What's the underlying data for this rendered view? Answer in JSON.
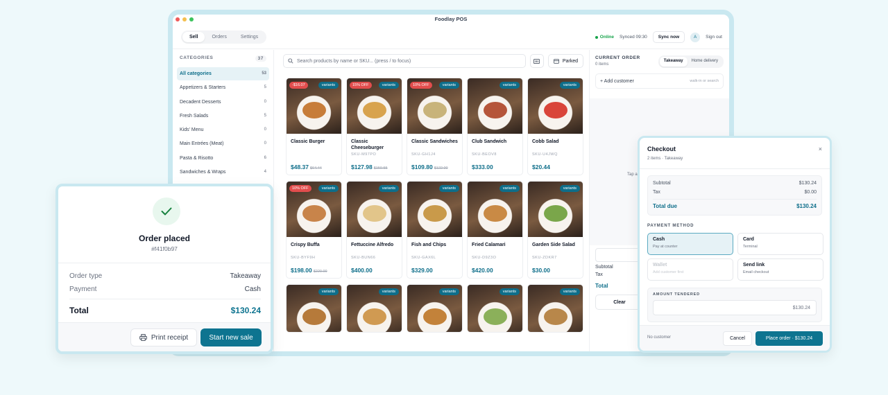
{
  "app": {
    "title": "Foodlay POS",
    "tabs": [
      {
        "label": "Sell",
        "active": true
      },
      {
        "label": "Orders",
        "active": false
      },
      {
        "label": "Settings",
        "active": false
      }
    ],
    "status": "Online",
    "synced": "Synced 09:30",
    "sync_button": "Sync now",
    "avatar": "A",
    "sign_out": "Sign out"
  },
  "sidebar": {
    "heading": "CATEGORIES",
    "count": "37",
    "items": [
      {
        "label": "All categories",
        "count": "53",
        "active": true
      },
      {
        "label": "Appetizers & Starters",
        "count": "5"
      },
      {
        "label": "Decadent Desserts",
        "count": "0"
      },
      {
        "label": "Fresh Salads",
        "count": "5"
      },
      {
        "label": "Kids' Menu",
        "count": "0"
      },
      {
        "label": "Main Entrées (Meat)",
        "count": "0"
      },
      {
        "label": "Pasta & Risotto",
        "count": "6"
      },
      {
        "label": "Sandwiches & Wraps",
        "count": "4"
      }
    ]
  },
  "search": {
    "placeholder": "Search products by name or SKU...  (press / to focus)",
    "parked_label": "Parked"
  },
  "products": [
    {
      "name": "Classic Burger",
      "sku": "",
      "price": "$48.37",
      "old": "$64.44",
      "discount": "-$16.07",
      "variants": "variants"
    },
    {
      "name": "Classic Cheeseburger",
      "sku": "SKU-M97PO",
      "price": "$127.98",
      "old": "$150.55",
      "discount": "15% OFF",
      "variants": "variants"
    },
    {
      "name": "Classic Sandwiches",
      "sku": "SKU-GH1J4",
      "price": "$109.80",
      "old": "$122.00",
      "discount": "10% OFF",
      "variants": "variants"
    },
    {
      "name": "Club Sandwich",
      "sku": "SKU-BEOV8",
      "price": "$333.00",
      "old": "",
      "discount": "",
      "variants": "variants"
    },
    {
      "name": "Cobb Salad",
      "sku": "SKU-U4JWQ",
      "price": "$20.44",
      "old": "",
      "discount": "",
      "variants": "variants"
    },
    {
      "name": "Crispy Buffa",
      "sku": "SKU-BYF9H",
      "price": "$198.00",
      "old": "$220.00",
      "discount": "10% OFF",
      "variants": "variants"
    },
    {
      "name": "Fettuccine Alfredo",
      "sku": "SKU-BUN66",
      "price": "$400.00",
      "old": "",
      "discount": "",
      "variants": "variants"
    },
    {
      "name": "Fish and Chips",
      "sku": "SKU-GAX6L",
      "price": "$329.00",
      "old": "",
      "discount": "",
      "variants": "variants"
    },
    {
      "name": "Fried Calamari",
      "sku": "SKU-D9Z3O",
      "price": "$420.00",
      "old": "",
      "discount": "",
      "variants": "variants"
    },
    {
      "name": "Garden Side Salad",
      "sku": "SKU-ZDKR7",
      "price": "$30.00",
      "old": "",
      "discount": "",
      "variants": "variants"
    },
    {
      "name": "",
      "sku": "",
      "price": "",
      "old": "",
      "discount": "",
      "variants": "variants"
    },
    {
      "name": "",
      "sku": "",
      "price": "",
      "old": "",
      "discount": "",
      "variants": "variants"
    },
    {
      "name": "",
      "sku": "",
      "price": "",
      "old": "",
      "discount": "",
      "variants": "variants"
    },
    {
      "name": "",
      "sku": "",
      "price": "",
      "old": "",
      "discount": "",
      "variants": "variants"
    },
    {
      "name": "",
      "sku": "",
      "price": "",
      "old": "",
      "discount": "",
      "variants": "variants"
    }
  ],
  "current_order": {
    "title": "CURRENT ORDER",
    "items": "0 items",
    "modes": [
      "Takeaway",
      "Home delivery"
    ],
    "add_customer": "+ Add customer",
    "walk_in": "walk-in or search",
    "tap_hint": "Tap a",
    "subtotal": "Subtotal",
    "tax": "Tax",
    "total": "Total",
    "clear": "Clear"
  },
  "order_placed": {
    "title": "Order placed",
    "id": "#f41f0b97",
    "order_type_label": "Order type",
    "order_type": "Takeaway",
    "payment_label": "Payment",
    "payment": "Cash",
    "total_label": "Total",
    "total": "$130.24",
    "print": "Print receipt",
    "new_sale": "Start new sale"
  },
  "checkout": {
    "title": "Checkout",
    "sub": "2 items · Takeaway",
    "close": "×",
    "subtotal_label": "Subtotal",
    "subtotal": "$130.24",
    "tax_label": "Tax",
    "tax": "$0.00",
    "due_label": "Total due",
    "due": "$130.24",
    "pm_label": "PAYMENT METHOD",
    "methods": [
      {
        "label": "Cash",
        "sub": "Pay at counter",
        "state": "active"
      },
      {
        "label": "Card",
        "sub": "Terminal",
        "state": "normal"
      },
      {
        "label": "Wallet",
        "sub": "Add customer first",
        "state": "disabled"
      },
      {
        "label": "Send link",
        "sub": "Email checkout",
        "state": "normal"
      }
    ],
    "tender_label": "AMOUNT TENDERED",
    "tender_value": "$130.24",
    "no_customer": "No customer",
    "cancel": "Cancel",
    "place": "Place order · $130.24"
  },
  "colors": {
    "accent": "#0e7490",
    "discount": "#e24d4d",
    "online": "#16a34a"
  }
}
